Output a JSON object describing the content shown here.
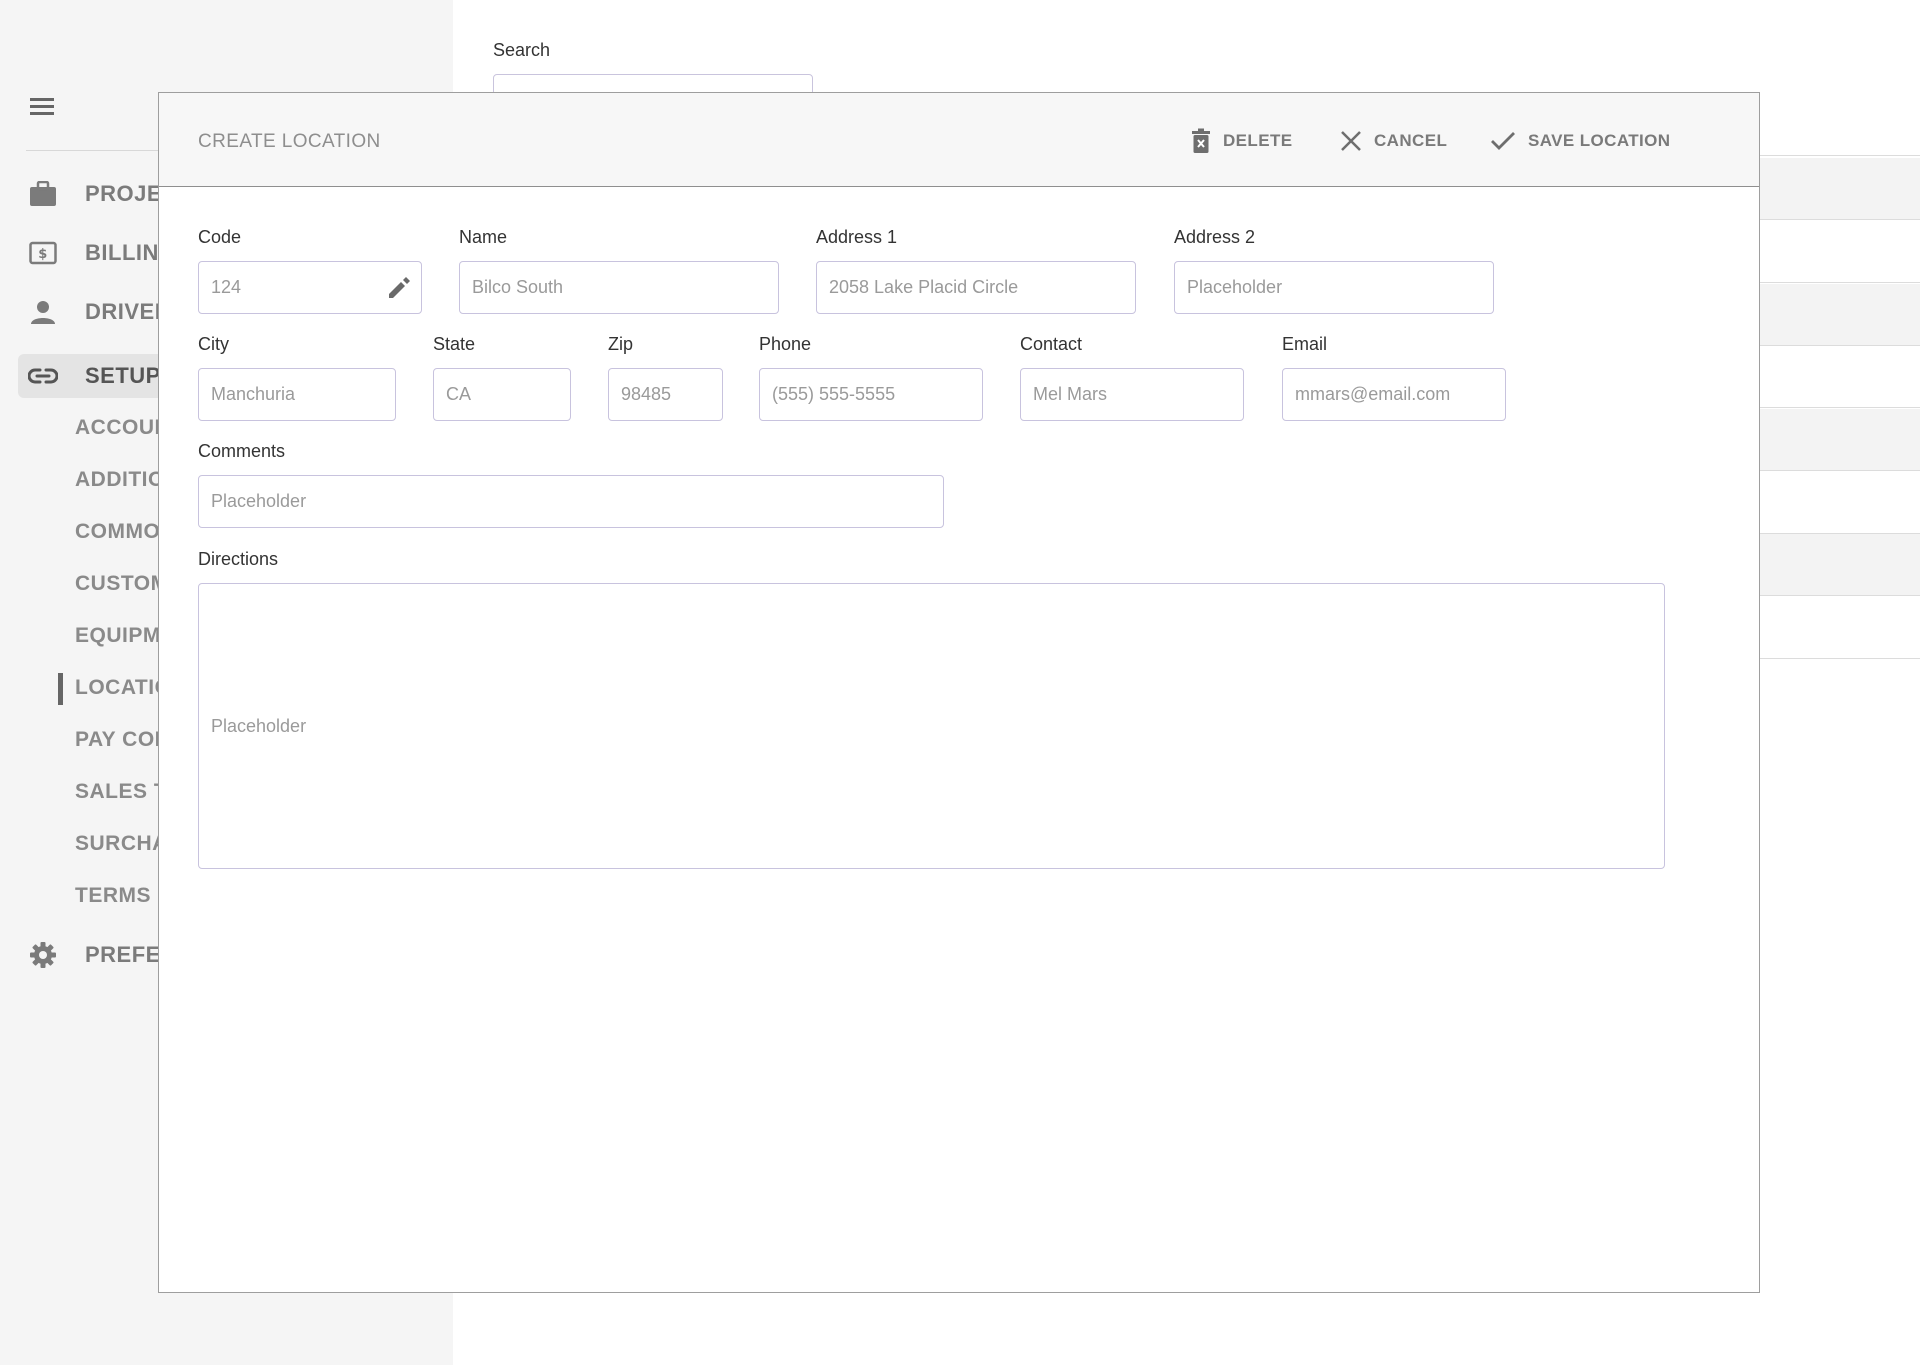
{
  "sidebar": {
    "nav_items": [
      {
        "label": "PROJEC",
        "icon": "briefcase-icon"
      },
      {
        "label": "BILLING",
        "icon": "dollar-icon"
      },
      {
        "label": "DRIVER I",
        "icon": "person-icon"
      },
      {
        "label": "SETUPS",
        "icon": "link-icon"
      },
      {
        "label": "PREFERI",
        "icon": "gear-icon"
      }
    ],
    "sub_items": [
      "ACCOUN",
      "ADDITIO",
      "COMMOI",
      "CUSTOM",
      "EQUIPM",
      "LOCATIO",
      "PAY COD",
      "SALES T/",
      "SURCHA",
      "TERMS C"
    ]
  },
  "background": {
    "search_label": "Search"
  },
  "modal": {
    "title": "CREATE LOCATION",
    "delete_label": "DELETE",
    "cancel_label": "CANCEL",
    "save_label": "SAVE LOCATION",
    "fields": {
      "code": {
        "label": "Code",
        "value": "124"
      },
      "name": {
        "label": "Name",
        "value": "Bilco South"
      },
      "address1": {
        "label": "Address 1",
        "value": "2058 Lake Placid Circle"
      },
      "address2": {
        "label": "Address 2",
        "value": "Placeholder"
      },
      "city": {
        "label": "City",
        "value": "Manchuria"
      },
      "state": {
        "label": "State",
        "value": "CA"
      },
      "zip": {
        "label": "Zip",
        "value": "98485"
      },
      "phone": {
        "label": "Phone",
        "value": "(555) 555-5555"
      },
      "contact": {
        "label": "Contact",
        "value": "Mel Mars"
      },
      "email": {
        "label": "Email",
        "value": "mmars@email.com"
      },
      "comments": {
        "label": "Comments",
        "value": "Placeholder"
      },
      "directions": {
        "label": "Directions",
        "value": "Placeholder"
      }
    }
  }
}
